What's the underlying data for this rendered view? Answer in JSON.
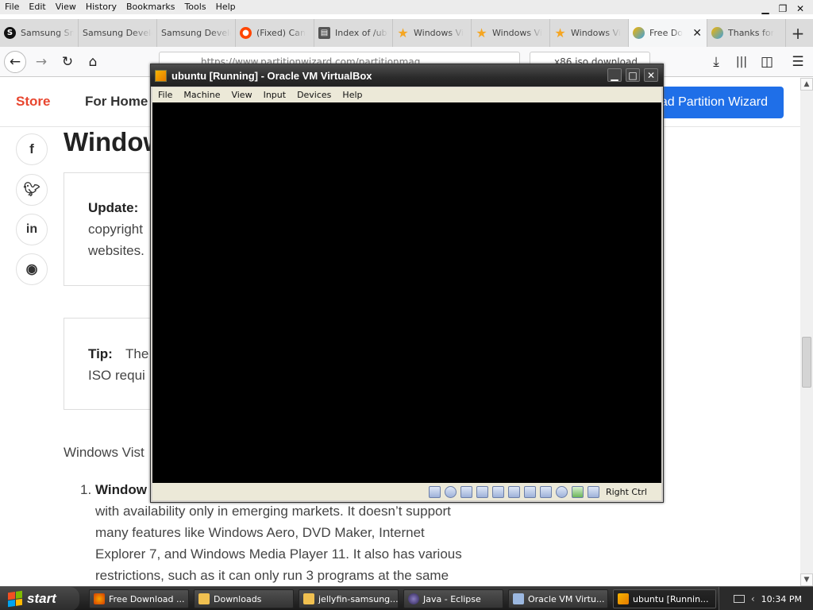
{
  "firefox": {
    "menu": [
      "File",
      "Edit",
      "View",
      "History",
      "Bookmarks",
      "Tools",
      "Help"
    ],
    "window_controls": [
      "minimize",
      "restore",
      "close"
    ]
  },
  "tabs": [
    {
      "title": "Samsung Sm",
      "icon": "samsung-s-icon",
      "color": "#111111"
    },
    {
      "title": "Samsung Develop",
      "icon": "none",
      "color": ""
    },
    {
      "title": "Samsung Develop",
      "icon": "none",
      "color": ""
    },
    {
      "title": "(Fixed) Can",
      "icon": "reddit-icon",
      "color": "#ff4500"
    },
    {
      "title": "Index of /ubu",
      "icon": "index-icon",
      "color": "#444444"
    },
    {
      "title": "Windows Vi",
      "icon": "star-icon",
      "color": "#f5a623"
    },
    {
      "title": "Windows Vi",
      "icon": "star-icon",
      "color": "#f5a623"
    },
    {
      "title": "Windows Vi",
      "icon": "star-icon",
      "color": "#f5a623"
    },
    {
      "title": "Free Do",
      "icon": "partition-wizard-icon",
      "color": "#e8a500",
      "active": true
    },
    {
      "title": "Thanks for",
      "icon": "partition-wizard-icon",
      "color": "#e8a500"
    }
  ],
  "nav": {
    "url": "https://www.partitionwizard.com/partitionmag",
    "search": "x86 iso download"
  },
  "page": {
    "store": "Store",
    "for_home": "For Home",
    "download_button": "ad Partition Wizard",
    "heading": "Window",
    "update_label": "Update:",
    "update_line2": "copyright",
    "update_line3": "websites.",
    "tip_label": "Tip:",
    "tip_line1": "The",
    "tip_line2": "ISO requi",
    "vista_line": "Windows Vist",
    "list_number": "1.",
    "list_bold": "Window",
    "list_lines": [
      "with availability only in emerging markets. It doesn’t support",
      "many features like Windows Aero, DVD Maker, Internet",
      "Explorer 7, and Windows Media Player 11. It also has various",
      "restrictions, such as it can only run 3 programs at the same"
    ]
  },
  "vbox": {
    "title": "ubuntu [Running] - Oracle VM VirtualBox",
    "menu": [
      "File",
      "Machine",
      "View",
      "Input",
      "Devices",
      "Help"
    ],
    "host_key": "Right Ctrl"
  },
  "taskbar": {
    "start": "start",
    "tasks": [
      {
        "label": "Free Download ...",
        "icon": "firefox-icon"
      },
      {
        "label": "Downloads",
        "icon": "folder-icon"
      },
      {
        "label": "jellyfin-samsung...",
        "icon": "folder-icon"
      },
      {
        "label": "Java - Eclipse",
        "icon": "eclipse-icon"
      },
      {
        "label": "Oracle VM Virtu...",
        "icon": "virtualbox-icon"
      },
      {
        "label": "ubuntu [Runnin...",
        "icon": "virtualbox-vm-icon",
        "active": true
      }
    ],
    "clock": "10:34 PM"
  }
}
